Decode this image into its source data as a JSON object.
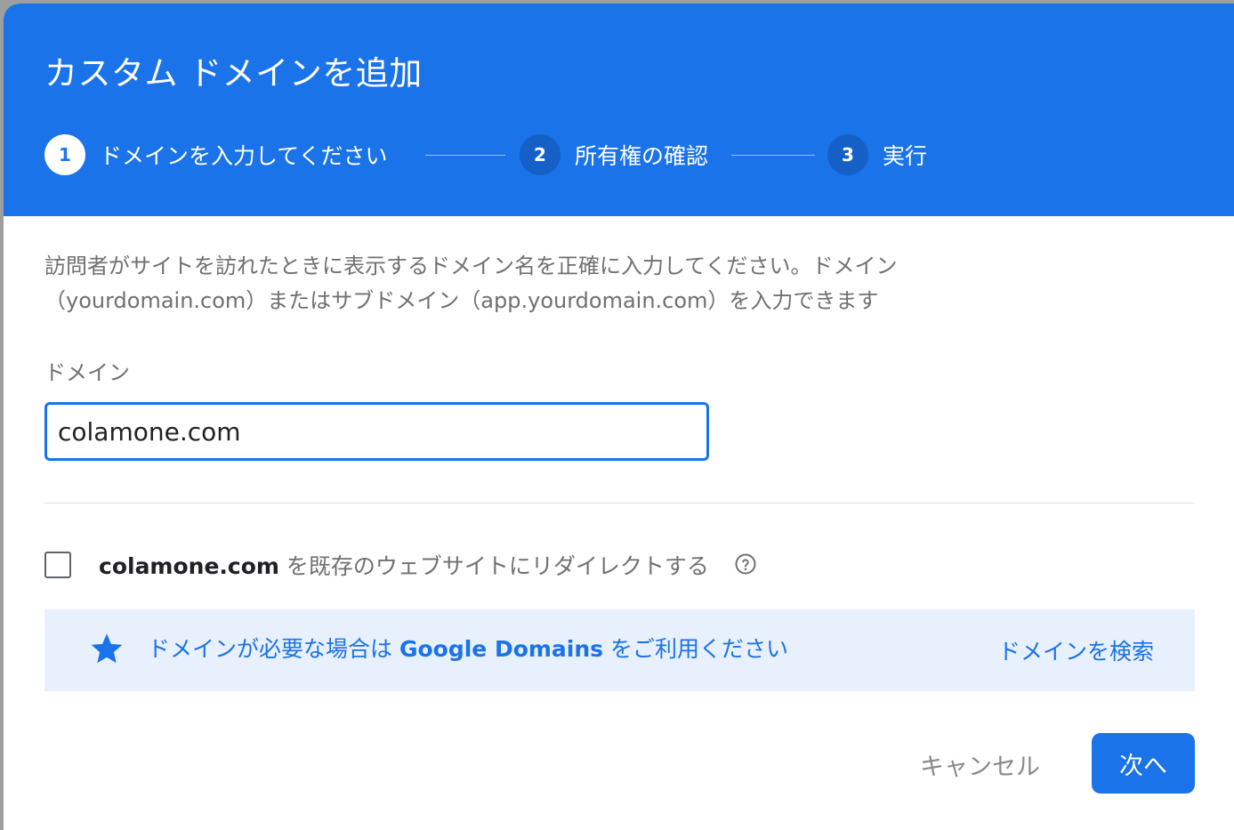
{
  "dialog": {
    "title": "カスタム ドメインを追加"
  },
  "steps": [
    {
      "number": "1",
      "label": "ドメインを入力してください"
    },
    {
      "number": "2",
      "label": "所有権の確認"
    },
    {
      "number": "3",
      "label": "実行"
    }
  ],
  "description": {
    "line1": "訪問者がサイトを訪れたときに表示するドメイン名を正確に入力してください。ドメイン",
    "line2": "（yourdomain.com）またはサブドメイン（app.yourdomain.com）を入力できます"
  },
  "domain_field": {
    "label": "ドメイン",
    "value": "colamone.com"
  },
  "redirect": {
    "domain": "colamone.com",
    "text": " を既存のウェブサイトにリダイレクトする",
    "checked": false,
    "help_icon": "help-circle-icon"
  },
  "banner": {
    "icon": "star-icon",
    "text_before": "ドメインが必要な場合は ",
    "brand": "Google Domains",
    "text_after": " をご利用ください",
    "link_label": "ドメインを検索"
  },
  "actions": {
    "cancel_label": "キャンセル",
    "next_label": "次へ"
  },
  "colors": {
    "accent": "#1a73e8",
    "banner_bg": "#e8f0fd"
  }
}
